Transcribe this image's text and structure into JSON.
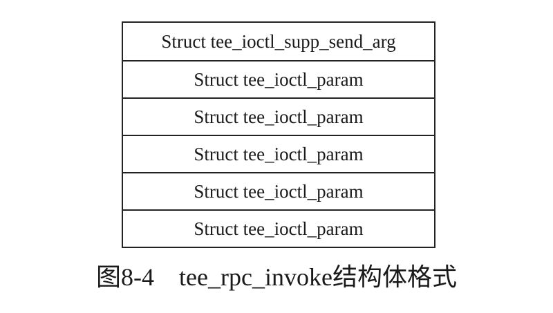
{
  "diagram": {
    "rows": [
      {
        "label": "Struct tee_ioctl_supp_send_arg"
      },
      {
        "label": "Struct tee_ioctl_param"
      },
      {
        "label": "Struct tee_ioctl_param"
      },
      {
        "label": "Struct tee_ioctl_param"
      },
      {
        "label": "Struct tee_ioctl_param"
      },
      {
        "label": "Struct tee_ioctl_param"
      }
    ],
    "caption": "图8-4    tee_rpc_invoke结构体格式"
  }
}
